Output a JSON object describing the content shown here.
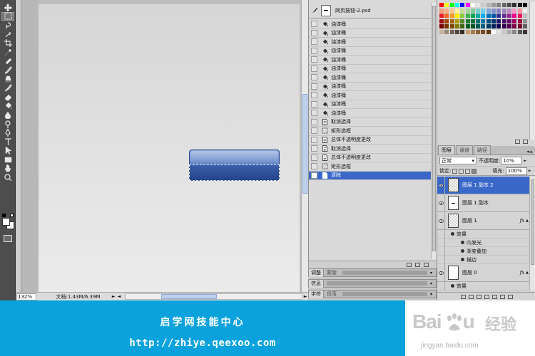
{
  "status_bar": {
    "zoom": "132%",
    "doc_info": "文档:1.43M/6.39M",
    "scroll_left": "◄",
    "scroll_right": "►",
    "info_arrow": "►"
  },
  "history": {
    "snapshot_name": "网页按钮-2.psd",
    "items": [
      {
        "label": "油漆桶",
        "icon": "paint-bucket"
      },
      {
        "label": "油漆桶",
        "icon": "paint-bucket"
      },
      {
        "label": "油漆桶",
        "icon": "paint-bucket"
      },
      {
        "label": "油漆桶",
        "icon": "paint-bucket"
      },
      {
        "label": "油漆桶",
        "icon": "paint-bucket"
      },
      {
        "label": "油漆桶",
        "icon": "paint-bucket"
      },
      {
        "label": "油漆桶",
        "icon": "paint-bucket"
      },
      {
        "label": "油漆桶",
        "icon": "paint-bucket"
      },
      {
        "label": "油漆桶",
        "icon": "paint-bucket"
      },
      {
        "label": "油漆桶",
        "icon": "paint-bucket"
      },
      {
        "label": "油漆桶",
        "icon": "paint-bucket"
      },
      {
        "label": "取消选择",
        "icon": "document"
      },
      {
        "label": "矩形选框",
        "icon": "marquee"
      },
      {
        "label": "总体不透明度更改",
        "icon": "document"
      },
      {
        "label": "取消选择",
        "icon": "document"
      },
      {
        "label": "总体不透明度更改",
        "icon": "document"
      },
      {
        "label": "矩形选框",
        "icon": "marquee"
      },
      {
        "label": "清除",
        "icon": "document",
        "active": true
      }
    ]
  },
  "collapsed_panels": [
    {
      "tab1": "调整",
      "tab2": "蒙版"
    },
    {
      "tab1": "信息",
      "tab2": ""
    },
    {
      "tab1": "字符",
      "tab2": "段落"
    }
  ],
  "layers_panel": {
    "tabs": [
      "图层",
      "通道",
      "路径"
    ],
    "blend_mode": "正常",
    "opacity_label": "不透明度:",
    "opacity_value": "10%",
    "lock_label": "锁定:",
    "fill_label": "填充:",
    "fill_value": "100%",
    "layers": [
      {
        "name": "图层 1 副本 2",
        "active": true,
        "thumb": "checker",
        "fx": false
      },
      {
        "name": "图层 1 副本",
        "active": false,
        "thumb": "plain",
        "fx": false
      },
      {
        "name": "图层 1",
        "active": false,
        "thumb": "checker",
        "fx": true,
        "effects_label": "效果",
        "effects": [
          "内发光",
          "渐变叠加",
          "描边"
        ]
      },
      {
        "name": "图层 0",
        "active": false,
        "thumb": "white",
        "fx": true,
        "effects_label": "效果",
        "effects": []
      }
    ]
  },
  "banner": {
    "title": "启学网技能中心",
    "url": "http://zhiye.qeexoo.com",
    "watermark_logo": "Bai",
    "watermark_logo_end": "u",
    "watermark_text": "经验",
    "watermark_sub": "jingyan.baidu.com"
  },
  "colors": {
    "selection_blue": "#3a68c9",
    "banner_blue": "#0aa2dd",
    "button_top": "#8aa6da",
    "button_bottom": "#23438c"
  }
}
